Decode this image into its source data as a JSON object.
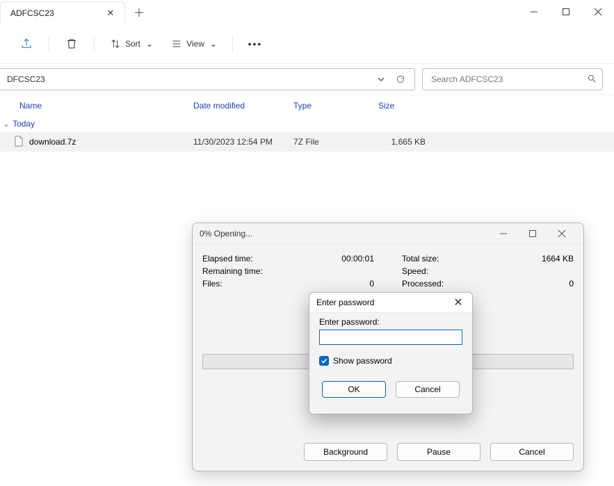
{
  "window": {
    "tab_title": "ADFCSC23"
  },
  "toolbar": {
    "sort_label": "Sort",
    "view_label": "View"
  },
  "address": {
    "path_text": "DFCSC23",
    "search_placeholder": "Search ADFCSC23"
  },
  "columns": {
    "name": "Name",
    "date": "Date modified",
    "type": "Type",
    "size": "Size"
  },
  "group_label": "Today",
  "files": [
    {
      "name": "download.7z",
      "date": "11/30/2023 12:54 PM",
      "type": "7Z File",
      "size": "1,665 KB"
    }
  ],
  "progress": {
    "title": "0% Opening...",
    "left": {
      "elapsed_k": "Elapsed time:",
      "elapsed_v": "00:00:01",
      "remaining_k": "Remaining time:",
      "remaining_v": "",
      "files_k": "Files:",
      "files_v": "0"
    },
    "right": {
      "total_k": "Total size:",
      "total_v": "1664 KB",
      "speed_k": "Speed:",
      "speed_v": "",
      "processed_k": "Processed:",
      "processed_v": "0"
    },
    "buttons": {
      "background": "Background",
      "pause": "Pause",
      "cancel": "Cancel"
    }
  },
  "password_dialog": {
    "title": "Enter password",
    "label": "Enter password:",
    "show_password_label": "Show password",
    "show_password_checked": true,
    "ok": "OK",
    "cancel": "Cancel"
  }
}
